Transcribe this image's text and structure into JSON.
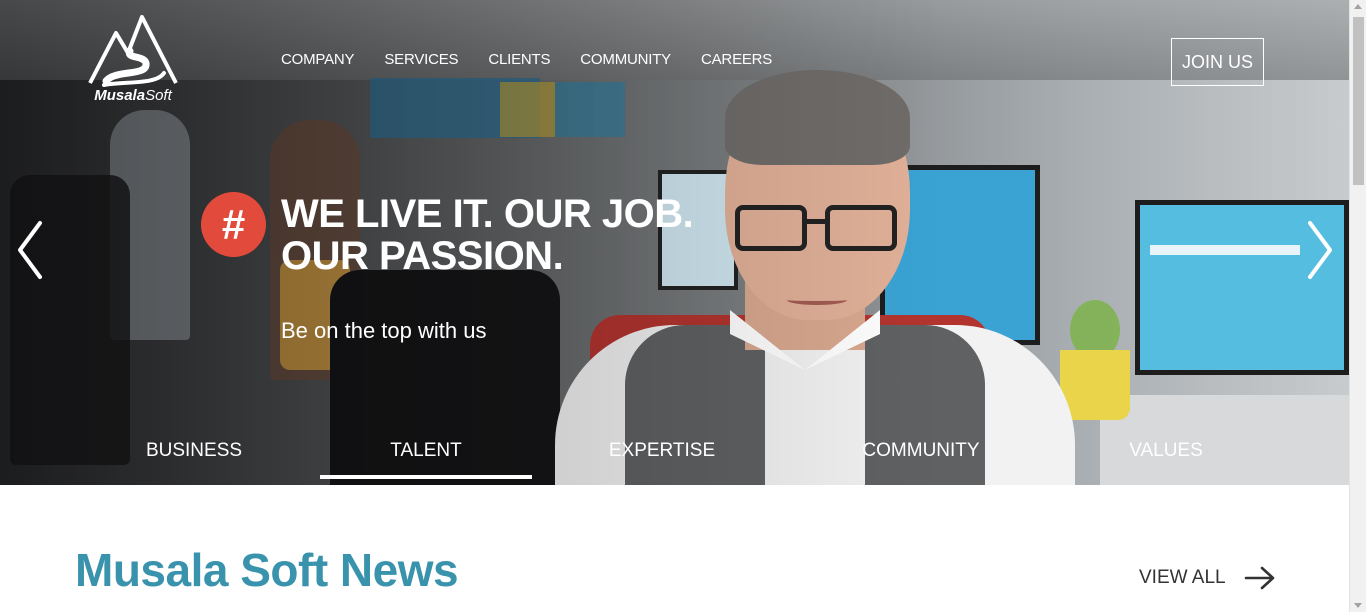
{
  "header": {
    "logo": {
      "brand_bold": "Musala",
      "brand_light": "Soft",
      "icon": "mountain-logo-icon"
    },
    "nav": [
      {
        "label": "COMPANY"
      },
      {
        "label": "SERVICES"
      },
      {
        "label": "CLIENTS"
      },
      {
        "label": "COMMUNITY"
      },
      {
        "label": "CAREERS"
      }
    ],
    "join_label": "JOIN US"
  },
  "hero": {
    "badge": "#",
    "headline_line1": "WE LIVE IT. OUR JOB.",
    "headline_line2": "OUR PASSION.",
    "subline": "Be on the top with us",
    "prev_icon": "chevron-left-icon",
    "next_icon": "chevron-right-icon",
    "badge_color": "#e24b3b"
  },
  "tabs": [
    {
      "label": "BUSINESS",
      "active": false
    },
    {
      "label": "TALENT",
      "active": true
    },
    {
      "label": "EXPERTISE",
      "active": false
    },
    {
      "label": "COMMUNITY",
      "active": false
    },
    {
      "label": "VALUES",
      "active": false
    }
  ],
  "news": {
    "title": "Musala Soft News",
    "view_all": "VIEW ALL",
    "view_all_icon": "arrow-right-icon",
    "title_color": "#3a93ad"
  }
}
